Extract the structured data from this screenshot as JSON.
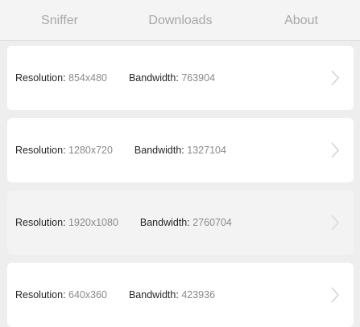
{
  "tabs": [
    {
      "label": "Sniffer"
    },
    {
      "label": "Downloads"
    },
    {
      "label": "About"
    }
  ],
  "labels": {
    "resolution": "Resolution:",
    "bandwidth": "Bandwidth:"
  },
  "streams": [
    {
      "resolution": "854x480",
      "bandwidth": "763904"
    },
    {
      "resolution": "1280x720",
      "bandwidth": "1327104"
    },
    {
      "resolution": "1920x1080",
      "bandwidth": "2760704"
    },
    {
      "resolution": "640x360",
      "bandwidth": "423936"
    }
  ],
  "colors": {
    "background": "#eeeeef",
    "card": "#ffffff",
    "card_selected": "#f3f3f3",
    "tab_text": "#a7a7a7"
  },
  "icons": {
    "row_arrow": "chevron-right-icon"
  }
}
